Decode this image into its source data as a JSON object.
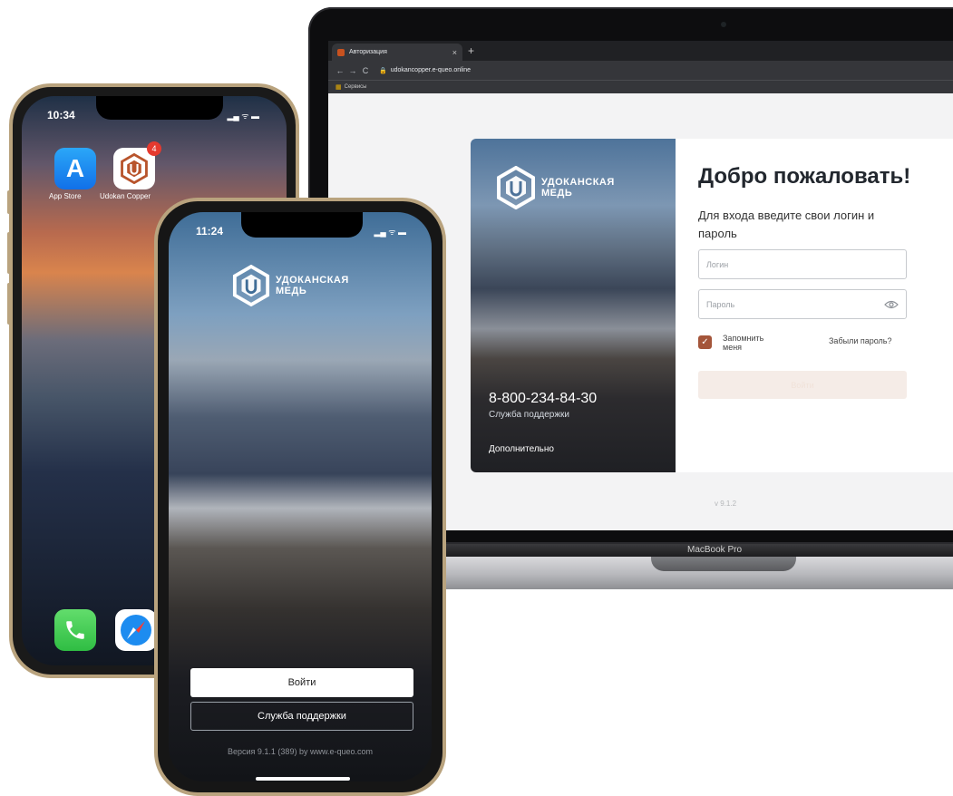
{
  "browser": {
    "tab_title": "Авторизация",
    "tab_close": "×",
    "new_tab": "+",
    "nav_back": "←",
    "nav_forward": "→",
    "nav_reload": "C",
    "url": "udokancopper.e-queo.online",
    "bookmark_label": "Сервисы"
  },
  "web": {
    "brand_line1": "УДОКАНСКАЯ",
    "brand_line2": "МЕДЬ",
    "phone": "8-800-234-84-30",
    "support_caption": "Служба поддержки",
    "more_link": "Дополнительно",
    "welcome_title": "Добро пожаловать!",
    "subtitle": "Для входа введите свои логин и пароль",
    "login_placeholder": "Логин",
    "password_placeholder": "Пароль",
    "remember_label": "Запомнить меня",
    "remember_checked": true,
    "forgot_link": "Забыли пароль?",
    "submit_label": "Войти",
    "version": "v 9.1.2",
    "accent_color": "#a4553a"
  },
  "laptop": {
    "model_label": "MacBook Pro"
  },
  "back_phone": {
    "time": "10:34",
    "status_glyphs": "▂▄ ᯤ ▬",
    "apps": [
      {
        "label": "App Store",
        "icon": "app-store-icon"
      },
      {
        "label": "Udokan Copper",
        "icon": "udokan-logo-icon",
        "badge": "4"
      }
    ],
    "dock": [
      {
        "icon": "phone-icon"
      },
      {
        "icon": "safari-icon"
      }
    ]
  },
  "front_phone": {
    "time": "11:24",
    "status_glyphs": "▂▄ ᯤ ▬",
    "brand_line1": "УДОКАНСКАЯ",
    "brand_line2": "МЕДЬ",
    "login_button": "Войти",
    "support_button": "Служба поддержки",
    "version": "Версия 9.1.1 (389) by www.e-queo.com"
  }
}
